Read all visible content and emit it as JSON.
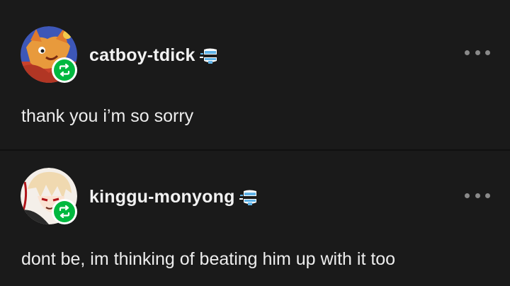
{
  "posts": [
    {
      "username": "catboy-tdick",
      "badge_icon": "reblog-icon",
      "verified_icon": "chattering-teeth-icon",
      "menu_icon": "more-options-icon",
      "text": "thank you i’m so sorry"
    },
    {
      "username": "kinggu-monyong",
      "badge_icon": "reblog-icon",
      "verified_icon": "chattering-teeth-icon",
      "menu_icon": "more-options-icon",
      "text": "dont be, im thinking of beating him up with it too"
    }
  ],
  "colors": {
    "background": "#1a1a1a",
    "text": "#ededed",
    "reblog_green": "#00b83f",
    "menu_dots": "#8a8a8a"
  }
}
